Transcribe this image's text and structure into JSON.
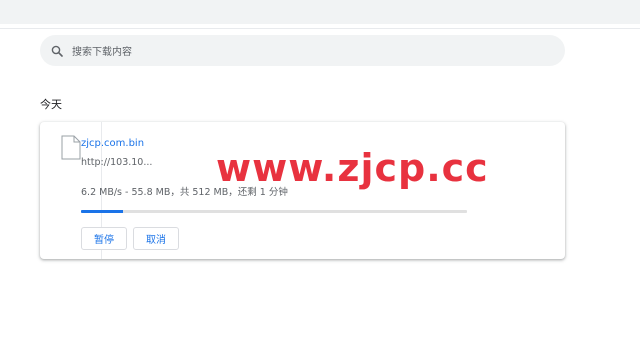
{
  "search": {
    "placeholder": "搜索下载内容"
  },
  "date_header": "今天",
  "download": {
    "file_name": "zjcp.com.bin",
    "url": "http://103.10...",
    "status": "6.2 MB/s - 55.8 MB，共 512 MB，还剩 1 分钟",
    "progress": 0.109,
    "pause_label": "暂停",
    "cancel_label": "取消"
  },
  "watermark": "www.zjcp.cc",
  "colors": {
    "accent": "#1a73e8",
    "watermark": "#e8323f",
    "search_bg": "#f1f3f4"
  }
}
